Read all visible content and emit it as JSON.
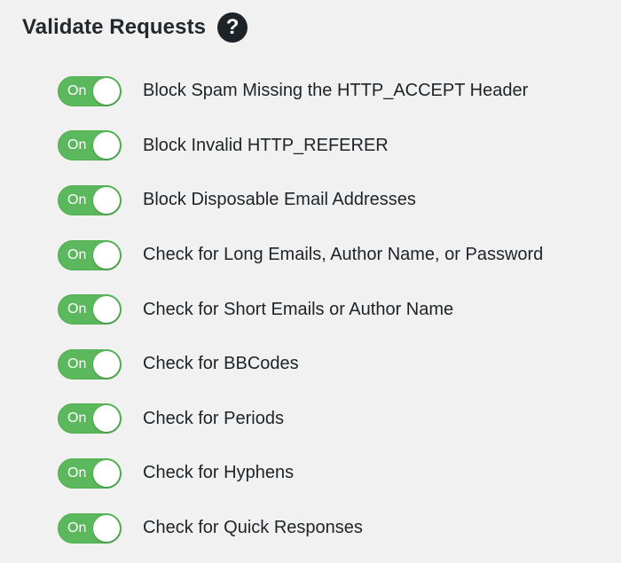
{
  "section": {
    "title": "Validate Requests",
    "help_icon": "question-mark-circle-icon",
    "help_glyph": "?"
  },
  "colors": {
    "toggle_on": "#5cb85c",
    "background": "#f1f1f1",
    "text": "#1d2327"
  },
  "options": [
    {
      "toggle_text": "On",
      "label": "Block Spam Missing the HTTP_ACCEPT Header",
      "state": "on"
    },
    {
      "toggle_text": "On",
      "label": "Block Invalid HTTP_REFERER",
      "state": "on"
    },
    {
      "toggle_text": "On",
      "label": "Block Disposable Email Addresses",
      "state": "on"
    },
    {
      "toggle_text": "On",
      "label": "Check for Long Emails, Author Name, or Password",
      "state": "on"
    },
    {
      "toggle_text": "On",
      "label": "Check for Short Emails or Author Name",
      "state": "on"
    },
    {
      "toggle_text": "On",
      "label": "Check for BBCodes",
      "state": "on"
    },
    {
      "toggle_text": "On",
      "label": "Check for Periods",
      "state": "on"
    },
    {
      "toggle_text": "On",
      "label": "Check for Hyphens",
      "state": "on"
    },
    {
      "toggle_text": "On",
      "label": "Check for Quick Responses",
      "state": "on"
    }
  ]
}
